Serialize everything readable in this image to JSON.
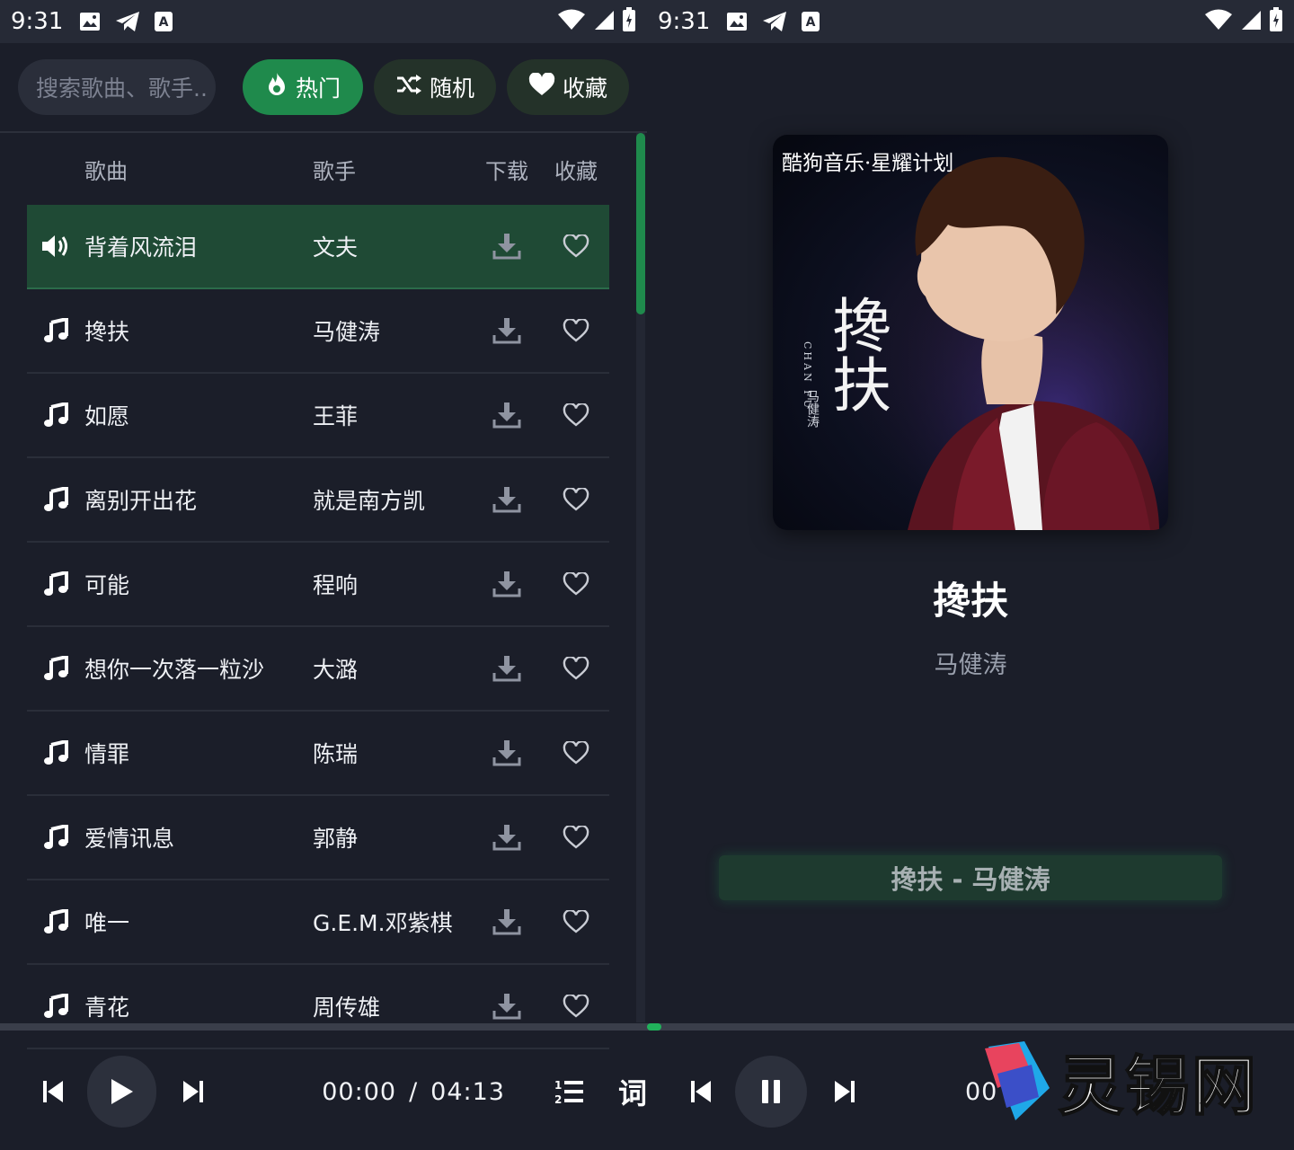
{
  "status": {
    "time": "9:31"
  },
  "toolbar": {
    "search_placeholder": "搜索歌曲、歌手..",
    "hot_label": "热门",
    "random_label": "随机",
    "favorites_label": "收藏"
  },
  "table": {
    "headers": {
      "song": "歌曲",
      "artist": "歌手",
      "download": "下载",
      "favorite": "收藏"
    },
    "rows": [
      {
        "song": "背着风流泪",
        "artist": "文夫"
      },
      {
        "song": "搀扶",
        "artist": "马健涛"
      },
      {
        "song": "如愿",
        "artist": "王菲"
      },
      {
        "song": "离别开出花",
        "artist": "就是南方凯"
      },
      {
        "song": "可能",
        "artist": "程响"
      },
      {
        "song": "想你一次落一粒沙",
        "artist": "大潞"
      },
      {
        "song": "情罪",
        "artist": "陈瑞"
      },
      {
        "song": "爱情讯息",
        "artist": "郭静"
      },
      {
        "song": "唯一",
        "artist": "G.E.M.邓紫棋"
      },
      {
        "song": "青花",
        "artist": "周传雄"
      }
    ]
  },
  "player": {
    "current_time": "00:00",
    "separator": "/",
    "total_time": "04:13",
    "lyrics_label": "词",
    "right_time_partial": "00",
    "progress_fraction": 0
  },
  "now_playing": {
    "cover_label": "酷狗音乐·星耀计划",
    "cover_title": "搀扶",
    "cover_vertical_en": "CHAN FU",
    "cover_vertical_cn": "马健涛",
    "title": "搀扶",
    "artist": "马健涛",
    "lyric_line": "搀扶 - 马健涛"
  },
  "watermark": {
    "text": "灵锡网"
  },
  "colors": {
    "accent": "#1f8a4c",
    "background": "#1b1e29",
    "row_active": "#1f4a35"
  }
}
